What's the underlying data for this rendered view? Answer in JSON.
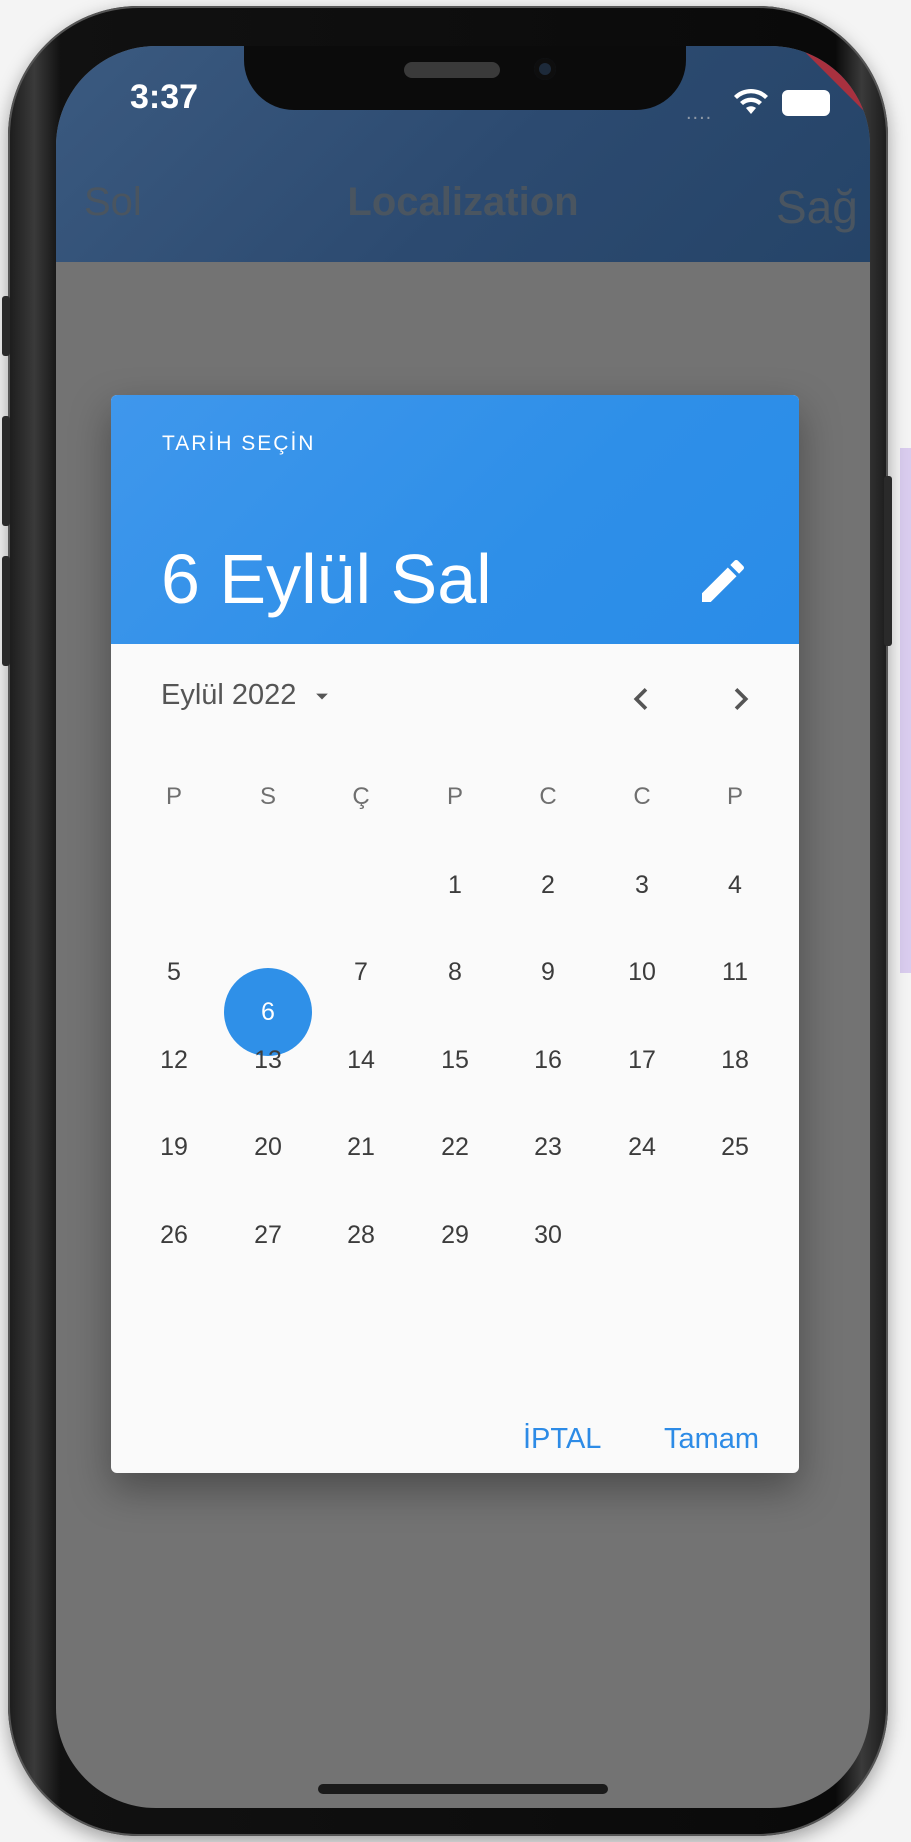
{
  "status_bar": {
    "time": "3:37",
    "signal": "...."
  },
  "debug_banner": "DEBUG",
  "app_bar": {
    "left_action": "Sol",
    "title": "Localization",
    "right_action": "Sağ"
  },
  "date_picker": {
    "help_text": "TARİH SEÇİN",
    "selected_date": "6 Eylül Sal",
    "month_label": "Eylül 2022",
    "weekdays": [
      "P",
      "S",
      "Ç",
      "P",
      "C",
      "C",
      "P"
    ],
    "weeks": [
      [
        "",
        "",
        "",
        "1",
        "2",
        "3",
        "4"
      ],
      [
        "5",
        "6",
        "7",
        "8",
        "9",
        "10",
        "11"
      ],
      [
        "12",
        "13",
        "14",
        "15",
        "16",
        "17",
        "18"
      ],
      [
        "19",
        "20",
        "21",
        "22",
        "23",
        "24",
        "25"
      ],
      [
        "26",
        "27",
        "28",
        "29",
        "30",
        "",
        ""
      ]
    ],
    "selected_day": "6",
    "cancel_label": "İPTAL",
    "ok_label": "Tamam"
  },
  "colors": {
    "accent": "#2f90e8",
    "app_bar": "#2c4a70",
    "scrim": "#737373",
    "debug": "#a8313f"
  },
  "icons": [
    "edit-icon",
    "dropdown-arrow-icon",
    "chevron-left-icon",
    "chevron-right-icon",
    "wifi-icon",
    "battery-icon"
  ]
}
